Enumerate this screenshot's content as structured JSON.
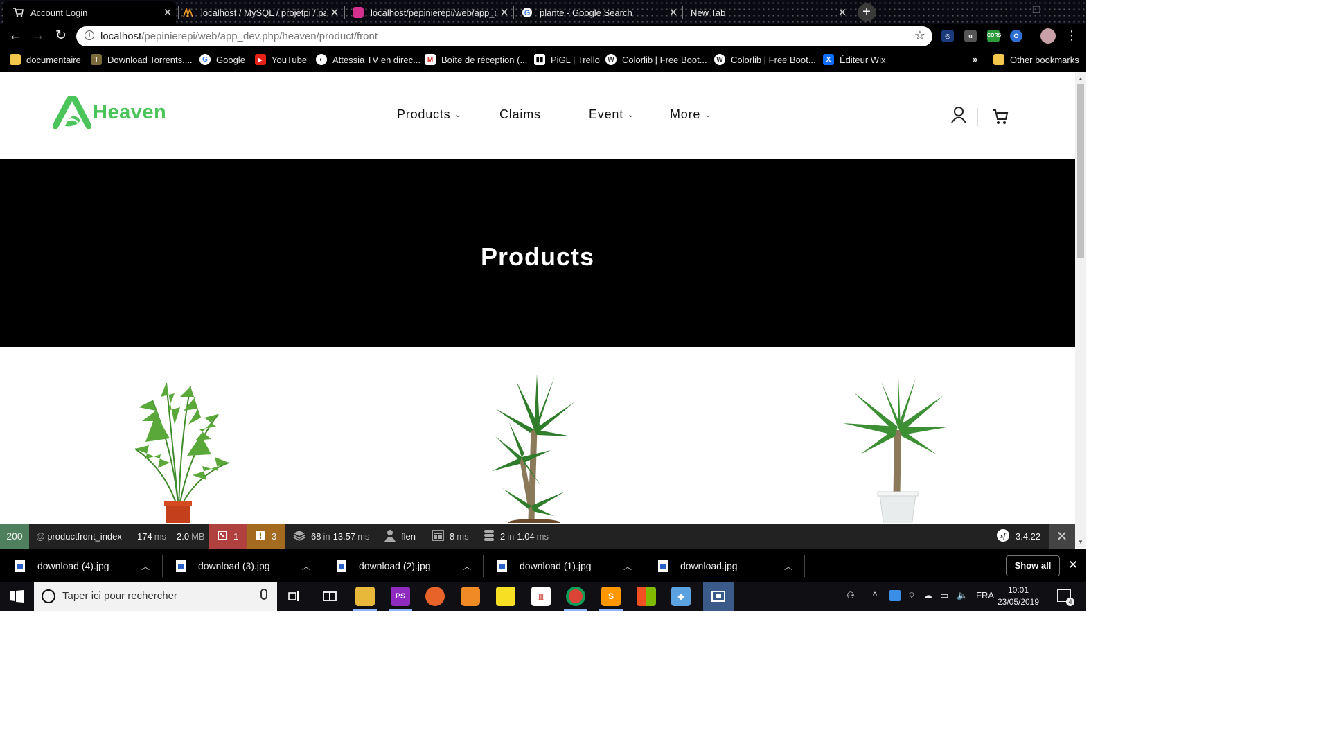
{
  "browser": {
    "tabs": [
      {
        "title": "Account Login",
        "icon": "cart-favicon",
        "active": true
      },
      {
        "title": "localhost / MySQL / projetpi / pa",
        "icon": "phpmyadmin-favicon"
      },
      {
        "title": "localhost/pepinierepi/web/app_d",
        "icon": "site-favicon"
      },
      {
        "title": "plante - Google Search",
        "icon": "google-favicon"
      },
      {
        "title": "New Tab",
        "icon": ""
      }
    ],
    "new_tab_label": "+",
    "url_host": "localhost",
    "url_path": "/pepinierepi/web/app_dev.php/heaven/product/front",
    "extensions": [
      "search-ext",
      "ublock-ext",
      "cors-ext",
      "o-ext",
      "profile-avatar"
    ],
    "bookmarks": [
      {
        "label": "documentaire",
        "icon": "folder-icon"
      },
      {
        "label": "Download Torrents....",
        "icon": "torrent-icon"
      },
      {
        "label": "Google",
        "icon": "google-icon"
      },
      {
        "label": "YouTube",
        "icon": "youtube-icon"
      },
      {
        "label": "Attessia TV en direc...",
        "icon": "globe-icon"
      },
      {
        "label": "Boîte de réception (...",
        "icon": "gmail-icon"
      },
      {
        "label": "PiGL | Trello",
        "icon": "trello-icon"
      },
      {
        "label": "Colorlib | Free Boot...",
        "icon": "wordpress-icon"
      },
      {
        "label": "Colorlib | Free Boot...",
        "icon": "wordpress-icon"
      },
      {
        "label": "Éditeur Wix",
        "icon": "wix-icon"
      }
    ],
    "bookmarks_overflow": "»",
    "other_bookmarks": "Other bookmarks"
  },
  "site": {
    "logo_text": "Heaven",
    "brand_color": "#4bc45a",
    "menu": [
      {
        "label": "Products",
        "has_dropdown": true
      },
      {
        "label": "Claims",
        "has_dropdown": false
      },
      {
        "label": "Event",
        "has_dropdown": true
      },
      {
        "label": "More",
        "has_dropdown": true
      }
    ],
    "hero_title": "Products",
    "products": [
      {
        "image": "areca-palm-in-terracotta-pot"
      },
      {
        "image": "yucca-plant-tall"
      },
      {
        "image": "yucca-plant-in-white-pot"
      }
    ]
  },
  "debug_toolbar": {
    "status": "200",
    "route": "productfront_index",
    "route_prefix": "@",
    "time_value": "174",
    "time_unit": "ms",
    "memory_value": "2.0",
    "memory_unit": "MB",
    "errors": "1",
    "warnings": "3",
    "cache_calls": "68",
    "cache_in": "in",
    "cache_time": "13.57",
    "cache_unit": "ms",
    "user": "flen",
    "twig_time": "8",
    "twig_unit": "ms",
    "db_queries": "2",
    "db_in": "in",
    "db_time": "1.04",
    "db_unit": "ms",
    "symfony_version": "3.4.22"
  },
  "downloads": {
    "files": [
      "download (4).jpg",
      "download (3).jpg",
      "download (2).jpg",
      "download (1).jpg",
      "download.jpg"
    ],
    "show_all": "Show all"
  },
  "taskbar": {
    "search_placeholder": "Taper ici pour rechercher",
    "language": "FRA",
    "time": "10:01",
    "date": "23/05/2019",
    "notifications": "4"
  }
}
